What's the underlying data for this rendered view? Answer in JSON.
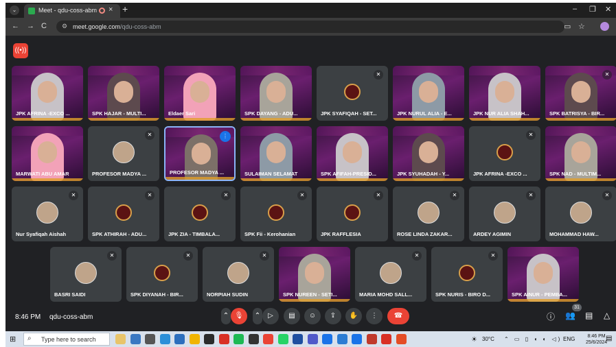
{
  "browser": {
    "tab_title": "Meet - qdu-coss-abm",
    "new_tab": "+",
    "url_host": "meet.google.com",
    "url_path": "/qdu-coss-abm",
    "back": "←",
    "forward": "→",
    "reload": "C",
    "minimize": "–",
    "maximize": "❐",
    "close": "✕",
    "menu": "⋮"
  },
  "meet": {
    "recording_icon": "recording-icon",
    "tiles": [
      {
        "name": "JPK AFRINA -EXCO ...",
        "type": "video",
        "muted": false
      },
      {
        "name": "SPK HAJAR - MULTI...",
        "type": "video",
        "muted": false
      },
      {
        "name": "Eldaer Sari",
        "type": "video",
        "muted": false
      },
      {
        "name": "SPK DAYANG - ADU...",
        "type": "video",
        "muted": false
      },
      {
        "name": "JPK SYAFIQAH - SET...",
        "type": "logo",
        "muted": true
      },
      {
        "name": "JPK NURUL ALIA - E...",
        "type": "video",
        "muted": false
      },
      {
        "name": "JPK NUR ALIA SHAH...",
        "type": "video",
        "muted": false
      },
      {
        "name": "SPK BATRISYA - BIR...",
        "type": "video",
        "muted": true
      },
      {
        "name": "MARWATI ABU AMAR",
        "type": "video",
        "muted": false
      },
      {
        "name": "PROFESOR MADYA ...",
        "type": "avatar",
        "muted": true
      },
      {
        "name": "PROFESOR MADYA ...",
        "type": "video",
        "muted": false,
        "speaking": true
      },
      {
        "name": "SULAIMAN SELAMAT",
        "type": "video",
        "muted": false
      },
      {
        "name": "SPK AFIFAH-PRESID...",
        "type": "video",
        "muted": false
      },
      {
        "name": "JPK SYUHADAH - Y...",
        "type": "video",
        "muted": false
      },
      {
        "name": "JPK AFRINA -EXCO ...",
        "type": "logo",
        "muted": true
      },
      {
        "name": "SPK NAD - MULTIM...",
        "type": "video",
        "muted": false
      },
      {
        "name": "Nur Syafiqah Aishah",
        "type": "avatar",
        "muted": true
      },
      {
        "name": "SPK ATHIRAH - ADU...",
        "type": "logo",
        "muted": true
      },
      {
        "name": "JPK ZIA - TIMBALA...",
        "type": "logo",
        "muted": true
      },
      {
        "name": "SPK Fii - Kerohanian",
        "type": "logo",
        "muted": true
      },
      {
        "name": "JPK RAFFLESIA",
        "type": "logo",
        "muted": true
      },
      {
        "name": "ROSE LINDA ZAKAR...",
        "type": "avatar",
        "muted": true
      },
      {
        "name": "ARDEY AGIMIN",
        "type": "avatar",
        "muted": true
      },
      {
        "name": "MOHAMMAD HAW...",
        "type": "avatar",
        "muted": true
      },
      {
        "name": "BASRI SAIDI",
        "type": "avatar",
        "muted": true
      },
      {
        "name": "SPK DIYANAH - BIR...",
        "type": "logo",
        "muted": true
      },
      {
        "name": "NORPIAH SUDIN",
        "type": "avatar",
        "muted": true
      },
      {
        "name": "SPK NUREEN - SETI...",
        "type": "video",
        "muted": false
      },
      {
        "name": "MARIA MOHD SALL...",
        "type": "avatar",
        "muted": true
      },
      {
        "name": "SPK NURIS - BIRO D...",
        "type": "logo",
        "muted": true
      },
      {
        "name": "SPK AINUR - PEMBA...",
        "type": "video",
        "muted": false
      }
    ],
    "time": "8:46 PM",
    "meeting_code": "qdu-coss-abm",
    "participant_count": "31",
    "mute_icon": "🎙",
    "colors": {
      "accent": "#8ab4f8",
      "end_call": "#ea4335",
      "background": "#202124"
    }
  },
  "taskbar": {
    "search_placeholder": "Type here to search",
    "weather": "30°C",
    "language": "ENG",
    "time": "8:46 PM",
    "date": "25/6/2024"
  }
}
